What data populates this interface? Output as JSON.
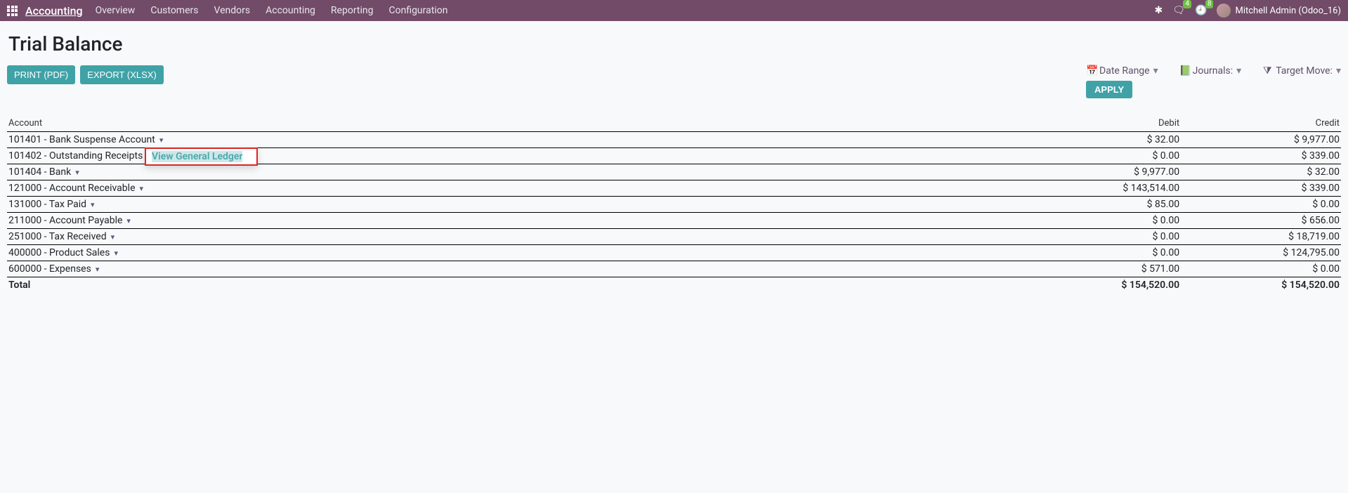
{
  "nav": {
    "brand": "Accounting",
    "menu": [
      "Overview",
      "Customers",
      "Vendors",
      "Accounting",
      "Reporting",
      "Configuration"
    ],
    "badges": {
      "messages": "4",
      "activities": "8"
    },
    "user": "Mitchell Admin (Odoo_16)"
  },
  "page": {
    "title": "Trial Balance",
    "btn_print": "PRINT (PDF)",
    "btn_export": "EXPORT (XLSX)",
    "btn_apply": "APPLY"
  },
  "filters": {
    "date_range": "Date Range",
    "journals": "Journals:",
    "target_move": "Target Move:"
  },
  "table": {
    "col_account": "Account",
    "col_debit": "Debit",
    "col_credit": "Credit",
    "rows": [
      {
        "account": "101401 - Bank Suspense Account",
        "debit": "$ 32.00",
        "credit": "$ 9,977.00"
      },
      {
        "account": "101402 - Outstanding Receipts",
        "debit": "$ 0.00",
        "credit": "$ 339.00"
      },
      {
        "account": "101404 - Bank",
        "debit": "$ 9,977.00",
        "credit": "$ 32.00"
      },
      {
        "account": "121000 - Account Receivable",
        "debit": "$ 143,514.00",
        "credit": "$ 339.00"
      },
      {
        "account": "131000 - Tax Paid",
        "debit": "$ 85.00",
        "credit": "$ 0.00"
      },
      {
        "account": "211000 - Account Payable",
        "debit": "$ 0.00",
        "credit": "$ 656.00"
      },
      {
        "account": "251000 - Tax Received",
        "debit": "$ 0.00",
        "credit": "$ 18,719.00"
      },
      {
        "account": "400000 - Product Sales",
        "debit": "$ 0.00",
        "credit": "$ 124,795.00"
      },
      {
        "account": "600000 - Expenses",
        "debit": "$ 571.00",
        "credit": "$ 0.00"
      }
    ],
    "total_label": "Total",
    "total_debit": "$ 154,520.00",
    "total_credit": "$ 154,520.00"
  },
  "popover": {
    "view_gl": "View General Ledger"
  }
}
